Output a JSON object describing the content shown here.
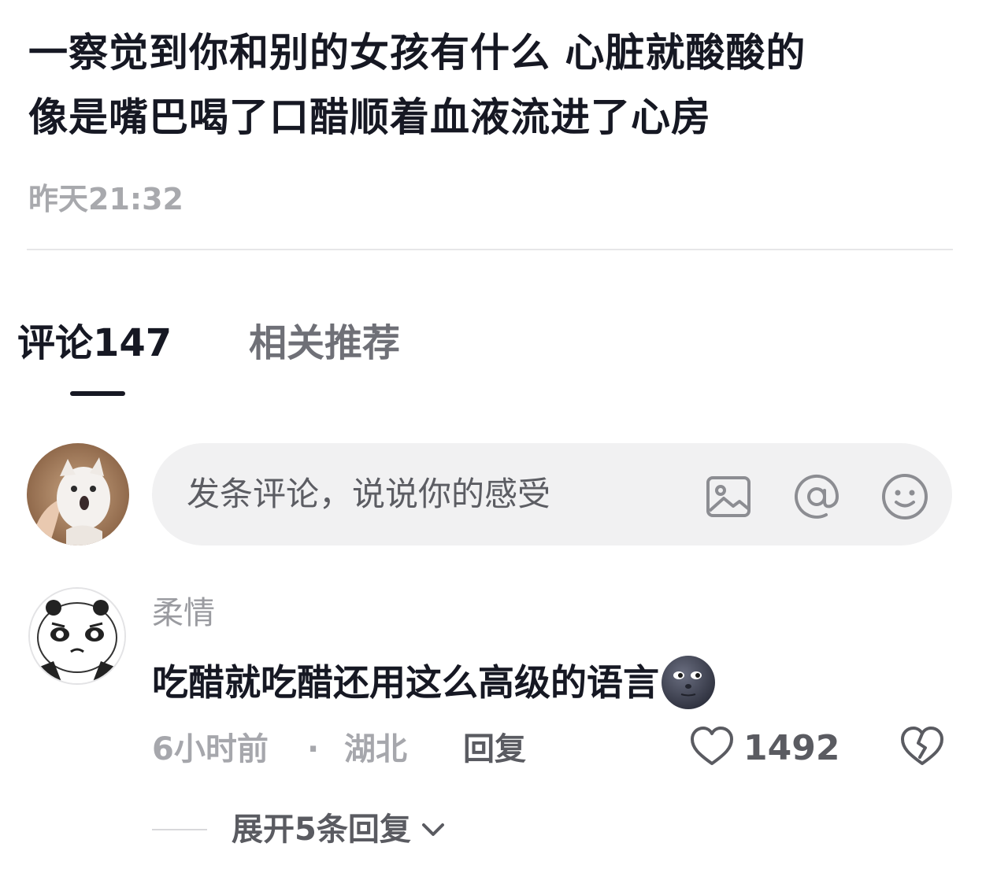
{
  "post": {
    "line1": "一察觉到你和别的女孩有什么 心脏就酸酸的",
    "line2": "像是嘴巴喝了口醋顺着血液流进了心房",
    "time": "昨天21:32"
  },
  "tabs": {
    "comments_label": "评论147",
    "related_label": "相关推荐"
  },
  "comment_input": {
    "placeholder": "发条评论，说说你的感受",
    "icons": [
      "image-icon",
      "at-icon",
      "emoji-icon"
    ]
  },
  "comment": {
    "author": "柔情",
    "text": "吃醋就吃醋还用这么高级的语言",
    "emoji": "new-moon-face-emoji",
    "time": "6小时前",
    "separator": "·",
    "location": "湖北",
    "reply_label": "回复",
    "likes": "1492",
    "expand_label": "展开5条回复"
  },
  "colors": {
    "text_primary": "#161823",
    "text_secondary": "#a6a7ac",
    "input_bg": "#f1f1f2",
    "divider": "#e6e6e8"
  }
}
